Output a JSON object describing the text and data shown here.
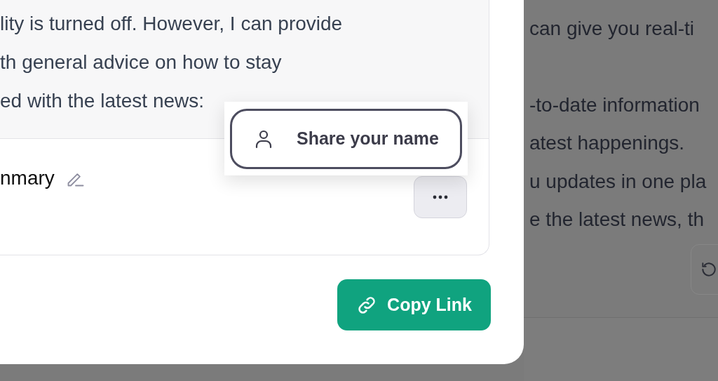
{
  "conversation": {
    "message_lines": [
      "can give you real-ti",
      "-to-date information",
      "atest happenings.",
      "u updates in one pla",
      "e the latest news, th"
    ]
  },
  "share_dialog": {
    "preview": {
      "message_lines": [
        "lity is turned off. However, I can provide",
        "th general advice on how to stay",
        "ed with the latest news:"
      ],
      "title": "nmary"
    },
    "name_menu": {
      "items": [
        {
          "label": "Share your name"
        }
      ]
    },
    "copy_link_button": {
      "label": "Copy Link"
    }
  }
}
